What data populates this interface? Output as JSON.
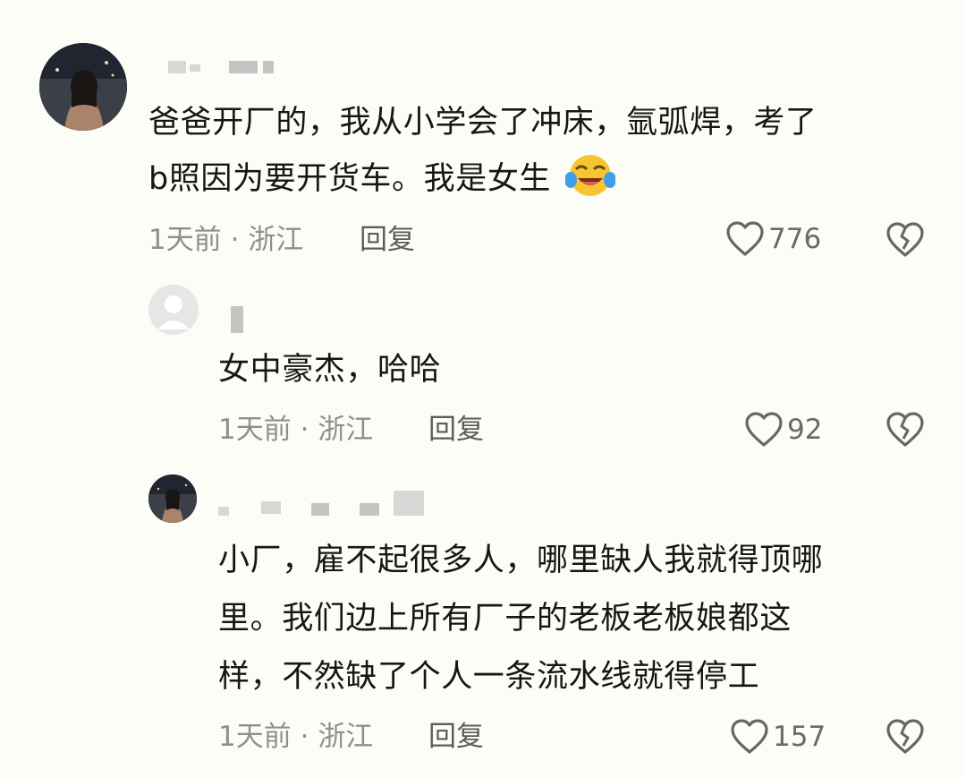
{
  "comments": [
    {
      "text_lines": [
        "爸爸开厂的，我从小学会了冲床，氩弧焊，考了",
        "b照因为要开货车。我是女生"
      ],
      "emoji": "laughing-crying-emoji",
      "time": "1天前",
      "location": "浙江",
      "reply_label": "回复",
      "likes": "776"
    },
    {
      "text_lines": [
        "女中豪杰，哈哈"
      ],
      "time": "1天前",
      "location": "浙江",
      "reply_label": "回复",
      "likes": "92"
    },
    {
      "text_lines": [
        "小厂，雇不起很多人，哪里缺人我就得顶哪",
        "里。我们边上所有厂子的老板老板娘都这",
        "样，不然缺了个人一条流水线就得停工"
      ],
      "time": "1天前",
      "location": "浙江",
      "reply_label": "回复",
      "likes": "157"
    }
  ],
  "meta_separator": "·",
  "icons": {
    "like": "heart-outline-icon",
    "dislike": "broken-heart-icon"
  },
  "colors": {
    "background": "#fdfdf8",
    "text": "#161616",
    "meta": "#8f8f8f",
    "emoji_face": "#f7c531",
    "emoji_tears": "#3ea0e8"
  }
}
